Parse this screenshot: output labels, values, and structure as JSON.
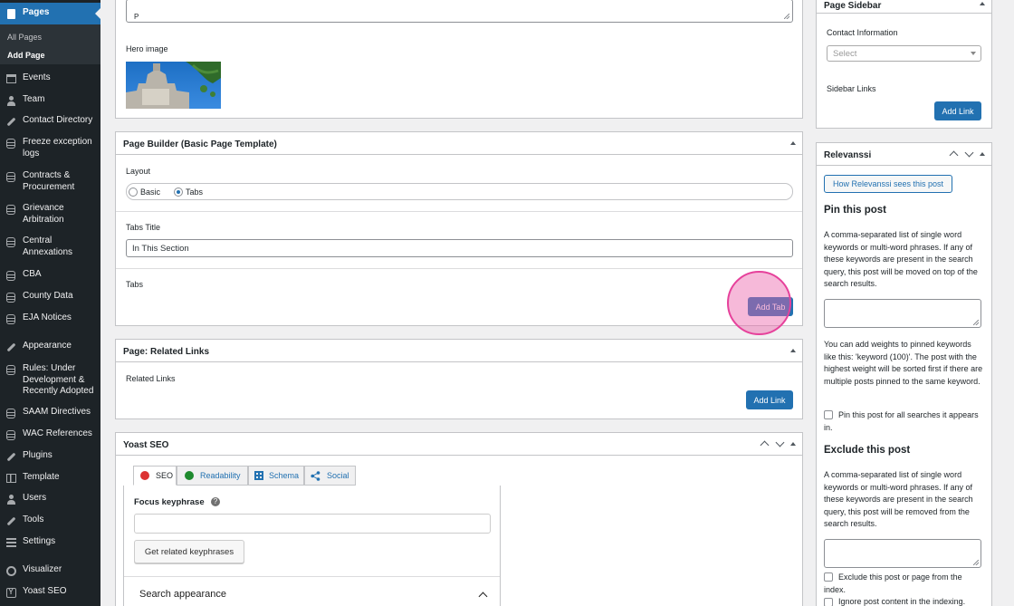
{
  "sidebar": {
    "current": "Pages",
    "submenu": [
      "All Pages",
      "Add Page"
    ],
    "items": [
      {
        "label": "Events",
        "icon": "calendar-icon"
      },
      {
        "label": "Team",
        "icon": "team-icon"
      },
      {
        "label": "Contact Directory",
        "icon": "wrench-icon"
      },
      {
        "label": "Freeze exception logs",
        "icon": "database-icon"
      },
      {
        "label": "Contracts & Procurement",
        "icon": "database-icon"
      },
      {
        "label": "Grievance Arbitration",
        "icon": "database-icon"
      },
      {
        "label": "Central Annexations",
        "icon": "database-icon"
      },
      {
        "label": "CBA",
        "icon": "database-icon"
      },
      {
        "label": "County Data",
        "icon": "database-icon"
      },
      {
        "label": "EJA Notices",
        "icon": "database-icon"
      },
      {
        "label": "Appearance",
        "icon": "brush-icon"
      },
      {
        "label": "Rules: Under Development & Recently Adopted",
        "icon": "database-icon"
      },
      {
        "label": "SAAM Directives",
        "icon": "database-icon"
      },
      {
        "label": "WAC References",
        "icon": "database-icon"
      },
      {
        "label": "Plugins",
        "icon": "plugin-icon"
      },
      {
        "label": "Template",
        "icon": "grid-icon"
      },
      {
        "label": "Users",
        "icon": "user-icon"
      },
      {
        "label": "Tools",
        "icon": "wrench-icon"
      },
      {
        "label": "Settings",
        "icon": "settings-icon"
      },
      {
        "label": "Visualizer",
        "icon": "visualizer-icon"
      },
      {
        "label": "Yoast SEO",
        "icon": "yoast-icon"
      }
    ]
  },
  "editor": {
    "path_text": "P",
    "hero_label": "Hero image"
  },
  "page_builder": {
    "title": "Page Builder (Basic Page Template)",
    "layout_label": "Layout",
    "layout_options": [
      "Basic",
      "Tabs"
    ],
    "layout_selected": "Tabs",
    "tabs_title_label": "Tabs Title",
    "tabs_title_value": "In This Section",
    "tabs_label": "Tabs",
    "add_tab": "Add Tab"
  },
  "related_links": {
    "title": "Page: Related Links",
    "label": "Related Links",
    "add_link": "Add Link"
  },
  "yoast": {
    "title": "Yoast SEO",
    "tabs": [
      "SEO",
      "Readability",
      "Schema",
      "Social"
    ],
    "focus_label": "Focus keyphrase",
    "focus_value": "",
    "related_btn": "Get related keyphrases",
    "search_appearance": "Search appearance"
  },
  "page_sidebar": {
    "title": "Page Sidebar",
    "contact_label": "Contact Information",
    "select_placeholder": "Select",
    "links_label": "Sidebar Links",
    "add_link": "Add Link"
  },
  "relevanssi": {
    "title": "Relevanssi",
    "how_btn": "How Relevanssi sees this post",
    "pin_title": "Pin this post",
    "pin_desc": "A comma-separated list of single word keywords or multi-word phrases. If any of these keywords are present in the search query, this post will be moved on top of the search results.",
    "weights_desc": "You can add weights to pinned keywords like this: 'keyword (100)'. The post with the highest weight will be sorted first if there are multiple posts pinned to the same keyword.",
    "pin_all": "Pin this post for all searches it appears in.",
    "exclude_title": "Exclude this post",
    "exclude_desc": "A comma-separated list of single word keywords or multi-word phrases. If any of these keywords are present in the search query, this post will be removed from the search results.",
    "exclude_index": "Exclude this post or page from the index.",
    "ignore_content": "Ignore post content in the indexing."
  },
  "colors": {
    "accent": "#2271b1",
    "sidebar_bg": "#1d2327",
    "highlight": "#e6419b"
  }
}
